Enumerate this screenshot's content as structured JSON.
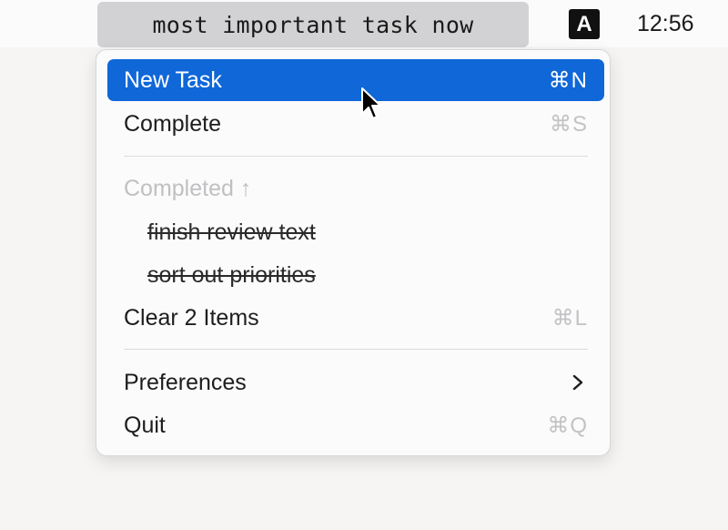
{
  "menubar": {
    "status_item_label": "most important task now",
    "input_source_label": "A",
    "clock": "12:56"
  },
  "menu": {
    "new_task": {
      "label": "New Task",
      "shortcut": "⌘N"
    },
    "complete": {
      "label": "Complete",
      "shortcut": "⌘S"
    },
    "completed_header": {
      "label": "Completed ↑"
    },
    "completed_items": [
      {
        "label": "finish review text"
      },
      {
        "label": "sort out priorities"
      }
    ],
    "clear_items": {
      "label": "Clear 2 Items",
      "shortcut": "⌘L"
    },
    "preferences": {
      "label": "Preferences",
      "submenu_icon": "chevron-right-icon"
    },
    "quit": {
      "label": "Quit",
      "shortcut": "⌘Q"
    }
  },
  "colors": {
    "highlight": "#0f67d8",
    "status_item_bg": "#d2d2d4",
    "disabled_text": "#c0c0c3"
  }
}
